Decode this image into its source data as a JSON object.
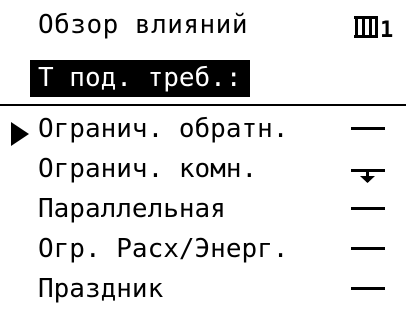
{
  "header": {
    "title": "Обзор влияний",
    "circuit_icon": "heating-circuit-icon",
    "circuit_number": "1"
  },
  "subtitle": {
    "label": "Т под. треб.:"
  },
  "menu": {
    "items": [
      {
        "label": "Огранич. обратн.",
        "selected": true,
        "status_icon": "dash-icon"
      },
      {
        "label": "Огранич. комн.",
        "selected": false,
        "status_icon": "arrow-down-limit-icon"
      },
      {
        "label": "Параллельная",
        "selected": false,
        "status_icon": "dash-icon"
      },
      {
        "label": "Огр. Расх/Энерг.",
        "selected": false,
        "status_icon": "dash-icon"
      },
      {
        "label": "Праздник",
        "selected": false,
        "status_icon": "dash-icon"
      }
    ]
  }
}
